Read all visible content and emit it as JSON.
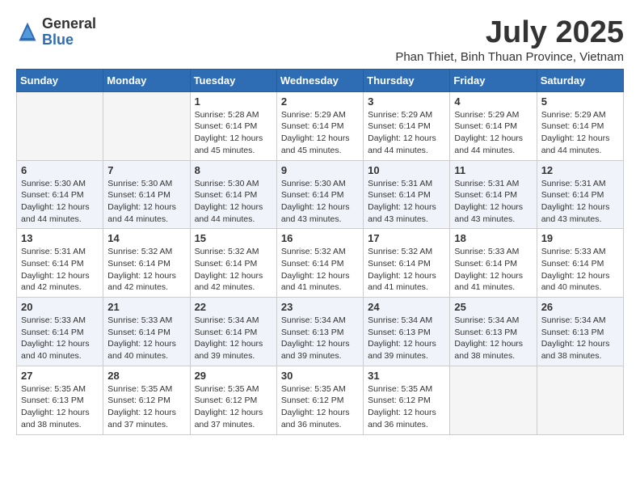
{
  "logo": {
    "general": "General",
    "blue": "Blue"
  },
  "title": "July 2025",
  "location": "Phan Thiet, Binh Thuan Province, Vietnam",
  "days_of_week": [
    "Sunday",
    "Monday",
    "Tuesday",
    "Wednesday",
    "Thursday",
    "Friday",
    "Saturday"
  ],
  "weeks": [
    [
      {
        "day": "",
        "info": ""
      },
      {
        "day": "",
        "info": ""
      },
      {
        "day": "1",
        "info": "Sunrise: 5:28 AM\nSunset: 6:14 PM\nDaylight: 12 hours and 45 minutes."
      },
      {
        "day": "2",
        "info": "Sunrise: 5:29 AM\nSunset: 6:14 PM\nDaylight: 12 hours and 45 minutes."
      },
      {
        "day": "3",
        "info": "Sunrise: 5:29 AM\nSunset: 6:14 PM\nDaylight: 12 hours and 44 minutes."
      },
      {
        "day": "4",
        "info": "Sunrise: 5:29 AM\nSunset: 6:14 PM\nDaylight: 12 hours and 44 minutes."
      },
      {
        "day": "5",
        "info": "Sunrise: 5:29 AM\nSunset: 6:14 PM\nDaylight: 12 hours and 44 minutes."
      }
    ],
    [
      {
        "day": "6",
        "info": "Sunrise: 5:30 AM\nSunset: 6:14 PM\nDaylight: 12 hours and 44 minutes."
      },
      {
        "day": "7",
        "info": "Sunrise: 5:30 AM\nSunset: 6:14 PM\nDaylight: 12 hours and 44 minutes."
      },
      {
        "day": "8",
        "info": "Sunrise: 5:30 AM\nSunset: 6:14 PM\nDaylight: 12 hours and 44 minutes."
      },
      {
        "day": "9",
        "info": "Sunrise: 5:30 AM\nSunset: 6:14 PM\nDaylight: 12 hours and 43 minutes."
      },
      {
        "day": "10",
        "info": "Sunrise: 5:31 AM\nSunset: 6:14 PM\nDaylight: 12 hours and 43 minutes."
      },
      {
        "day": "11",
        "info": "Sunrise: 5:31 AM\nSunset: 6:14 PM\nDaylight: 12 hours and 43 minutes."
      },
      {
        "day": "12",
        "info": "Sunrise: 5:31 AM\nSunset: 6:14 PM\nDaylight: 12 hours and 43 minutes."
      }
    ],
    [
      {
        "day": "13",
        "info": "Sunrise: 5:31 AM\nSunset: 6:14 PM\nDaylight: 12 hours and 42 minutes."
      },
      {
        "day": "14",
        "info": "Sunrise: 5:32 AM\nSunset: 6:14 PM\nDaylight: 12 hours and 42 minutes."
      },
      {
        "day": "15",
        "info": "Sunrise: 5:32 AM\nSunset: 6:14 PM\nDaylight: 12 hours and 42 minutes."
      },
      {
        "day": "16",
        "info": "Sunrise: 5:32 AM\nSunset: 6:14 PM\nDaylight: 12 hours and 41 minutes."
      },
      {
        "day": "17",
        "info": "Sunrise: 5:32 AM\nSunset: 6:14 PM\nDaylight: 12 hours and 41 minutes."
      },
      {
        "day": "18",
        "info": "Sunrise: 5:33 AM\nSunset: 6:14 PM\nDaylight: 12 hours and 41 minutes."
      },
      {
        "day": "19",
        "info": "Sunrise: 5:33 AM\nSunset: 6:14 PM\nDaylight: 12 hours and 40 minutes."
      }
    ],
    [
      {
        "day": "20",
        "info": "Sunrise: 5:33 AM\nSunset: 6:14 PM\nDaylight: 12 hours and 40 minutes."
      },
      {
        "day": "21",
        "info": "Sunrise: 5:33 AM\nSunset: 6:14 PM\nDaylight: 12 hours and 40 minutes."
      },
      {
        "day": "22",
        "info": "Sunrise: 5:34 AM\nSunset: 6:14 PM\nDaylight: 12 hours and 39 minutes."
      },
      {
        "day": "23",
        "info": "Sunrise: 5:34 AM\nSunset: 6:13 PM\nDaylight: 12 hours and 39 minutes."
      },
      {
        "day": "24",
        "info": "Sunrise: 5:34 AM\nSunset: 6:13 PM\nDaylight: 12 hours and 39 minutes."
      },
      {
        "day": "25",
        "info": "Sunrise: 5:34 AM\nSunset: 6:13 PM\nDaylight: 12 hours and 38 minutes."
      },
      {
        "day": "26",
        "info": "Sunrise: 5:34 AM\nSunset: 6:13 PM\nDaylight: 12 hours and 38 minutes."
      }
    ],
    [
      {
        "day": "27",
        "info": "Sunrise: 5:35 AM\nSunset: 6:13 PM\nDaylight: 12 hours and 38 minutes."
      },
      {
        "day": "28",
        "info": "Sunrise: 5:35 AM\nSunset: 6:12 PM\nDaylight: 12 hours and 37 minutes."
      },
      {
        "day": "29",
        "info": "Sunrise: 5:35 AM\nSunset: 6:12 PM\nDaylight: 12 hours and 37 minutes."
      },
      {
        "day": "30",
        "info": "Sunrise: 5:35 AM\nSunset: 6:12 PM\nDaylight: 12 hours and 36 minutes."
      },
      {
        "day": "31",
        "info": "Sunrise: 5:35 AM\nSunset: 6:12 PM\nDaylight: 12 hours and 36 minutes."
      },
      {
        "day": "",
        "info": ""
      },
      {
        "day": "",
        "info": ""
      }
    ]
  ]
}
